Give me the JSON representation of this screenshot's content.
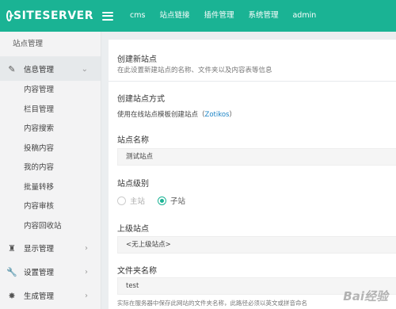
{
  "header": {
    "brand": "SITESERVER",
    "nav": [
      "cms",
      "站点链接",
      "插件管理",
      "系统管理",
      "admin"
    ]
  },
  "sidebar": {
    "title": "站点管理",
    "groups": [
      {
        "label": "信息管理",
        "icon": "edit-icon",
        "expanded": true
      },
      {
        "label": "显示管理",
        "icon": "tshirt-icon"
      },
      {
        "label": "设置管理",
        "icon": "wrench-icon"
      },
      {
        "label": "生成管理",
        "icon": "magic-icon"
      }
    ],
    "sub_items": [
      "内容管理",
      "栏目管理",
      "内容搜索",
      "投稿内容",
      "我的内容",
      "批量转移",
      "内容审核",
      "内容回收站"
    ]
  },
  "form": {
    "title": "创建新站点",
    "desc": "在此设置新建站点的名称、文件夹以及内容表等信息",
    "method_label": "创建站点方式",
    "method_text_prefix": "使用在线站点模板创建站点（",
    "method_link": "Zotikos",
    "method_text_suffix": "）",
    "name_label": "站点名称",
    "name_value": "测试站点",
    "level_label": "站点级别",
    "level_options": [
      "主站",
      "子站"
    ],
    "level_selected": "子站",
    "parent_label": "上级站点",
    "parent_value": "<无上级站点>",
    "folder_label": "文件夹名称",
    "folder_value": "test",
    "folder_hint": "实际在服务器中保存此网站的文件夹名称，此路径必须以英文或拼音命名"
  },
  "watermark": "Bai经验"
}
